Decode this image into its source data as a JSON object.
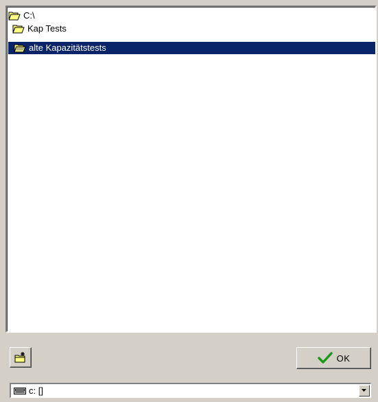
{
  "tree": {
    "items": [
      {
        "label": "C:\\",
        "icon": "open-folder-icon"
      },
      {
        "label": "Kap Tests",
        "icon": "open-folder-icon"
      },
      {
        "label": "alte Kapazitätstests",
        "icon": "open-folder-icon",
        "selected": true
      }
    ]
  },
  "buttons": {
    "new_folder_icon": "new-folder-icon",
    "ok_label": "OK"
  },
  "drive": {
    "value": "c: []",
    "icon": "drive-icon"
  },
  "colors": {
    "background": "#d4d0c8",
    "selection": "#0a246a",
    "check": "#1a9a1a"
  }
}
